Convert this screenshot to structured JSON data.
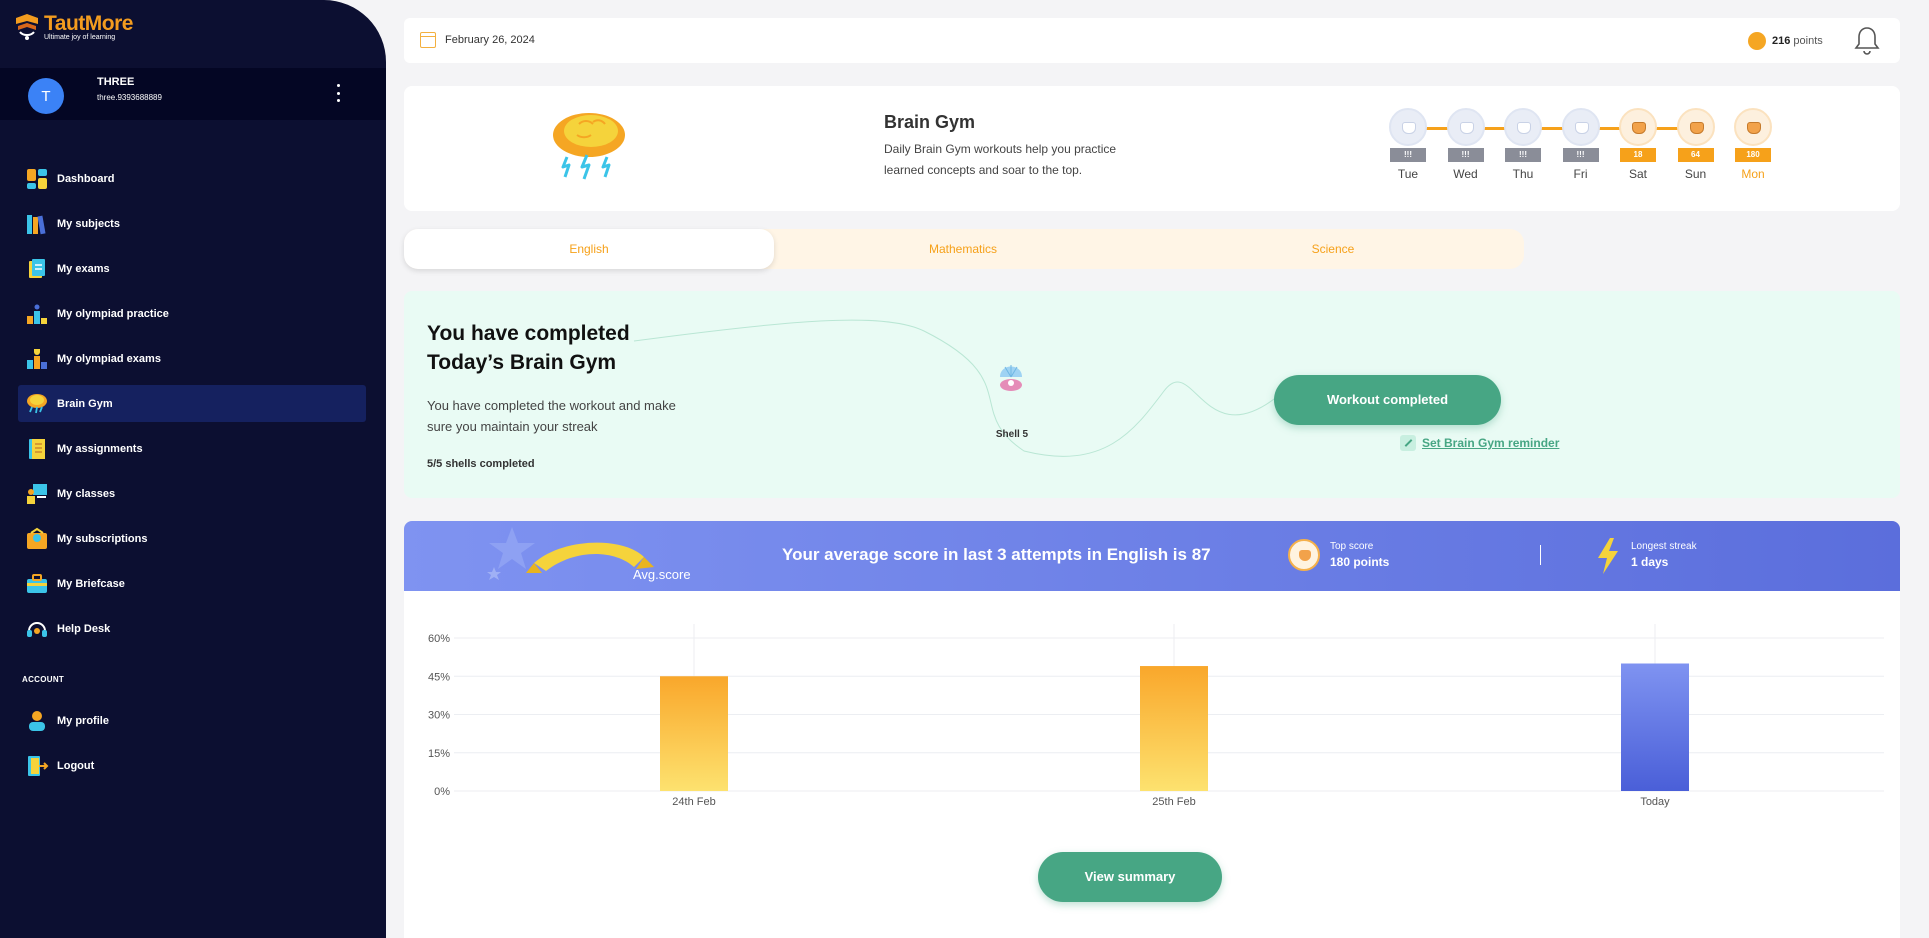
{
  "app": {
    "brand_title": "TautMore",
    "brand_tagline": "Ultimate joy of learning"
  },
  "user": {
    "avatar_letter": "T",
    "name": "THREE",
    "id": "three.9393688889"
  },
  "sidebar": {
    "items": [
      {
        "label": "Dashboard",
        "icon": "dashboard-icon"
      },
      {
        "label": "My subjects",
        "icon": "books-icon"
      },
      {
        "label": "My exams",
        "icon": "exam-paper-icon"
      },
      {
        "label": "My olympiad practice",
        "icon": "podium-practice-icon"
      },
      {
        "label": "My olympiad exams",
        "icon": "trophy-podium-icon"
      },
      {
        "label": "Brain Gym",
        "icon": "brain-cloud-icon",
        "active": true
      },
      {
        "label": "My assignments",
        "icon": "notebook-icon"
      },
      {
        "label": "My classes",
        "icon": "classroom-icon"
      },
      {
        "label": "My subscriptions",
        "icon": "subscription-icon"
      },
      {
        "label": "My Briefcase",
        "icon": "briefcase-icon"
      },
      {
        "label": "Help Desk",
        "icon": "headset-icon"
      }
    ],
    "account_heading": "ACCOUNT",
    "account_items": [
      {
        "label": "My profile",
        "icon": "profile-icon"
      },
      {
        "label": "Logout",
        "icon": "logout-icon"
      }
    ]
  },
  "topbar": {
    "date": "February 26, 2024",
    "points_value": "216",
    "points_unit": "points"
  },
  "brain_gym": {
    "title": "Brain Gym",
    "description": "Daily Brain Gym workouts help you practice learned concepts and soar to the top.",
    "days": [
      {
        "day": "Tue",
        "score": "!!!",
        "state": "gray"
      },
      {
        "day": "Wed",
        "score": "!!!",
        "state": "gray"
      },
      {
        "day": "Thu",
        "score": "!!!",
        "state": "gray"
      },
      {
        "day": "Fri",
        "score": "!!!",
        "state": "gray"
      },
      {
        "day": "Sat",
        "score": "18",
        "state": "gold"
      },
      {
        "day": "Sun",
        "score": "64",
        "state": "gold"
      },
      {
        "day": "Mon",
        "score": "180",
        "state": "gold",
        "today": true
      }
    ]
  },
  "tabs": [
    {
      "label": "English",
      "active": true
    },
    {
      "label": "Mathematics"
    },
    {
      "label": "Science"
    }
  ],
  "completion": {
    "title": "You have completed Today’s Brain Gym",
    "text": "You have completed the workout and make sure you maintain your streak",
    "shells": "5/5 shells completed",
    "shell_label": "Shell 5",
    "button": "Workout completed",
    "reminder": "Set Brain Gym reminder"
  },
  "score": {
    "avg_label": "Avg.score",
    "headline": "Your average score in last 3 attempts in English is 87",
    "top_label": "Top score",
    "top_value": "180 points",
    "streak_label": "Longest streak",
    "streak_value": "1 days"
  },
  "chart_data": {
    "type": "bar",
    "categories": [
      "24th Feb",
      "25th Feb",
      "Today"
    ],
    "values": [
      45,
      49,
      50
    ],
    "ylim": [
      0,
      60
    ],
    "yticks": [
      "0%",
      "15%",
      "30%",
      "45%",
      "60%"
    ],
    "colors": {
      "past": "#f9a72b",
      "today": "#5b6edc"
    },
    "grid": true
  },
  "actions": {
    "view_summary": "View summary"
  }
}
